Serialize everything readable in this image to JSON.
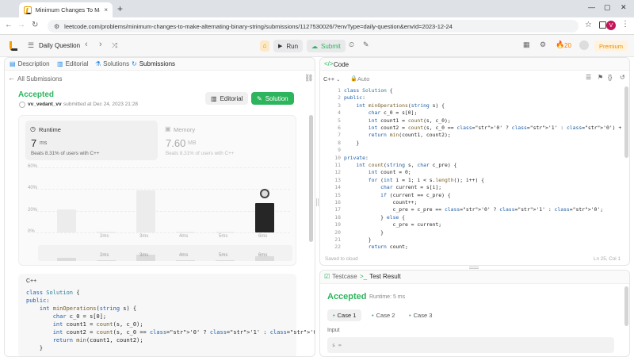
{
  "browser": {
    "tab_title": "Minimum Changes To Make Alte",
    "tab_close": "×",
    "new_tab": "+",
    "url": "leetcode.com/problems/minimum-changes-to-make-alternating-binary-string/submissions/1127530026/?envType=daily-question&envId=2023-12-24",
    "profile_initial": "V"
  },
  "header": {
    "daily": "Daily Question",
    "run": "Run",
    "submit": "Submit",
    "streak": "20",
    "premium": "Premium"
  },
  "left_tabs": [
    "Description",
    "Editorial",
    "Solutions",
    "Submissions"
  ],
  "submission": {
    "back": "All Submissions",
    "status": "Accepted",
    "user": "vv_vedant_vv",
    "submitted": "submitted at Dec 24, 2023 21:28",
    "editorial_btn": "Editorial",
    "solution_btn": "Solution",
    "runtime_label": "Runtime",
    "runtime_value": "7",
    "runtime_unit": "ms",
    "runtime_beats": "Beats 8.31% of users with C++",
    "memory_label": "Memory",
    "memory_value": "7.60",
    "memory_unit": "MB",
    "memory_beats": "Beats 8.31% of users with C++"
  },
  "chart_data": {
    "type": "bar",
    "categories": [
      "1ms",
      "2ms",
      "3ms",
      "4ms",
      "5ms",
      "6ms"
    ],
    "tick_labels": [
      "2ms",
      "3ms",
      "4ms",
      "5ms",
      "6ms"
    ],
    "values": [
      21,
      1,
      39,
      1,
      1,
      27
    ],
    "highlight_index": 5,
    "ylabels": [
      "60%",
      "40%",
      "20%",
      "0%"
    ],
    "ylim": [
      0,
      60
    ],
    "mini_tick_labels": [
      "2ms",
      "3ms",
      "4ms",
      "5ms",
      "6ms"
    ]
  },
  "left_code": {
    "lang": "C++",
    "lines": [
      "class Solution {",
      "public:",
      "    int minOperations(string s) {",
      "        char c_0 = s[0];",
      "        int count1 = count(s, c_0);",
      "        int count2 = count(s, c_0 == '0' ? '1' : '0') + 1;",
      "        return min(count1, count2);",
      "    }"
    ]
  },
  "code_panel": {
    "title": "Code",
    "lang": "C++",
    "auto": "Auto",
    "saved": "Saved to cloud",
    "position": "Ln 25, Col 1",
    "lines": [
      "class Solution {",
      "public:",
      "    int minOperations(string s) {",
      "        char c_0 = s[0];",
      "        int count1 = count(s, c_0);",
      "        int count2 = count(s, c_0 == '0' ? '1' : '0') + 1;",
      "        return min(count1, count2);",
      "    }",
      "",
      "private:",
      "    int count(string s, char c_pre) {",
      "        int count = 0;",
      "        for (int i = 1; i < s.length(); i++) {",
      "            char current = s[i];",
      "            if (current == c_pre) {",
      "                count++;",
      "                c_pre = c_pre == '0' ? '1' : '0';",
      "            } else {",
      "                c_pre = current;",
      "            }",
      "        }",
      "        return count;"
    ]
  },
  "test_panel": {
    "testcase_tab": "Testcase",
    "result_tab": "Test Result",
    "status": "Accepted",
    "runtime": "Runtime: 5 ms",
    "cases": [
      "Case 1",
      "Case 2",
      "Case 3"
    ],
    "input_label": "Input",
    "input_value": "s ="
  }
}
